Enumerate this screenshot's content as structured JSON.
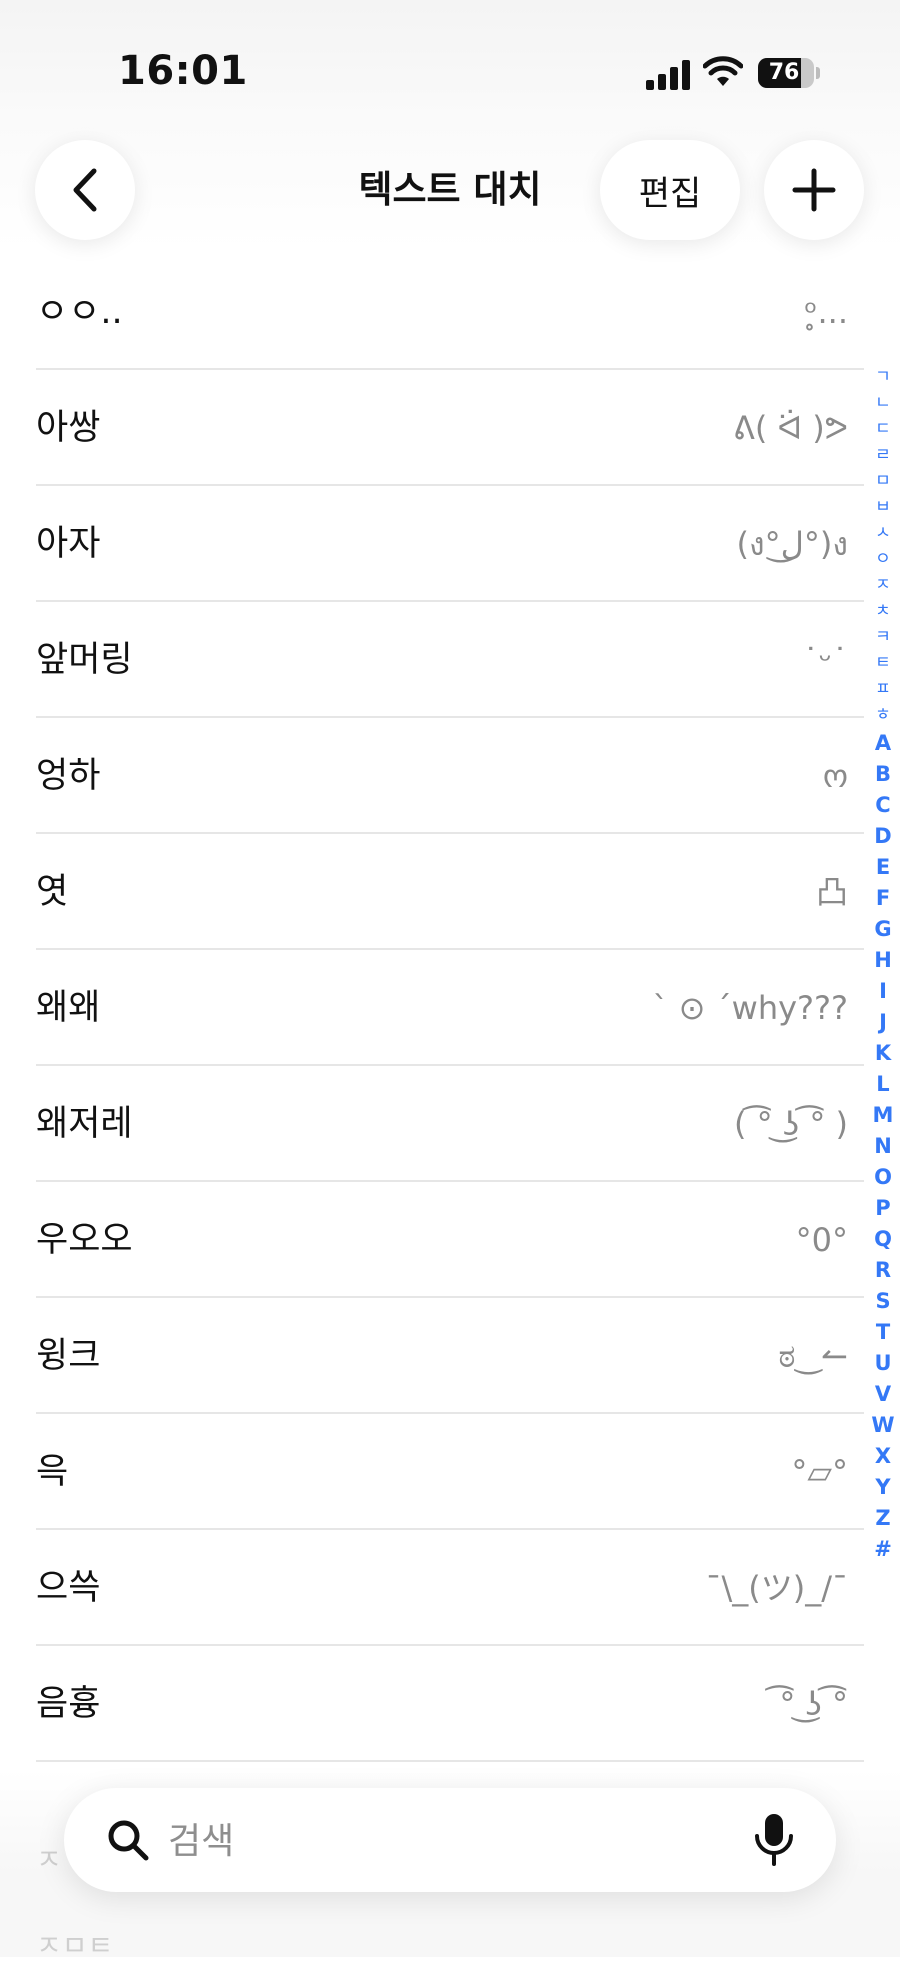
{
  "status_bar": {
    "time": "16:01",
    "battery": "76",
    "battery_level": 0.76
  },
  "nav": {
    "title": "텍스트 대치",
    "edit_label": "편집"
  },
  "rows": [
    {
      "phrase": "ㅇㅇ..",
      "shortcut": "ᵒ̥..."
    },
    {
      "phrase": "아쌍",
      "shortcut": "ᕕ( ᐛ )ᕗ"
    },
    {
      "phrase": "아자",
      "shortcut": "(ง°ل͜°)ง"
    },
    {
      "phrase": "앞머링",
      "shortcut": "˙ᵕ˙"
    },
    {
      "phrase": "엉하",
      "shortcut": "ო"
    },
    {
      "phrase": "엿",
      "shortcut": "凸"
    },
    {
      "phrase": "왜왜",
      "shortcut": "ˋ ⊙ ˊwhy???"
    },
    {
      "phrase": "왜저레",
      "shortcut": "( ͡° ͜ʖ ͡° )"
    },
    {
      "phrase": "우오오",
      "shortcut": "°0°"
    },
    {
      "phrase": "윙크",
      "shortcut": "ಠ‿↼"
    },
    {
      "phrase": "윽",
      "shortcut": "°▱°"
    },
    {
      "phrase": "으쓱",
      "shortcut": "¯\\_(ツ)_/¯"
    },
    {
      "phrase": "음흉",
      "shortcut": "͡° ͜ʖ ͡°"
    }
  ],
  "faded_rows": [
    "ㅈ",
    "ㅈㅁㅌ"
  ],
  "index_korean": [
    "ㄱ",
    "ㄴ",
    "ㄷ",
    "ㄹ",
    "ㅁ",
    "ㅂ",
    "ㅅ",
    "ㅇ",
    "ㅈ",
    "ㅊ",
    "ㅋ",
    "ㅌ",
    "ㅍ",
    "ㅎ"
  ],
  "index_latin": [
    "A",
    "B",
    "C",
    "D",
    "E",
    "F",
    "G",
    "H",
    "I",
    "J",
    "K",
    "L",
    "M",
    "N",
    "O",
    "P",
    "Q",
    "R",
    "S",
    "T",
    "U",
    "V",
    "W",
    "X",
    "Y",
    "Z",
    "#"
  ],
  "search": {
    "placeholder": "검색"
  },
  "colors": {
    "accent": "#3478f6",
    "separator": "#e6e6e6",
    "secondary_text": "#8a8a8a"
  }
}
